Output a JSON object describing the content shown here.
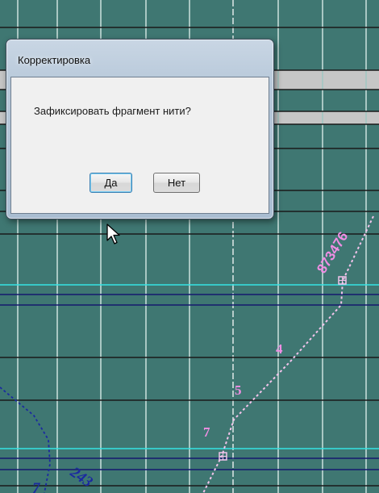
{
  "dialog": {
    "title": "Корректировка",
    "message": "Зафиксировать фрагмент нити?",
    "yes_label": "Да",
    "no_label": "Нет"
  },
  "canvas": {
    "background": "#3f7772",
    "labels": {
      "top_number": "873476",
      "num4": "4",
      "num5": "5",
      "num7a": "7",
      "num7b": "7",
      "bottom_number": "243"
    }
  }
}
